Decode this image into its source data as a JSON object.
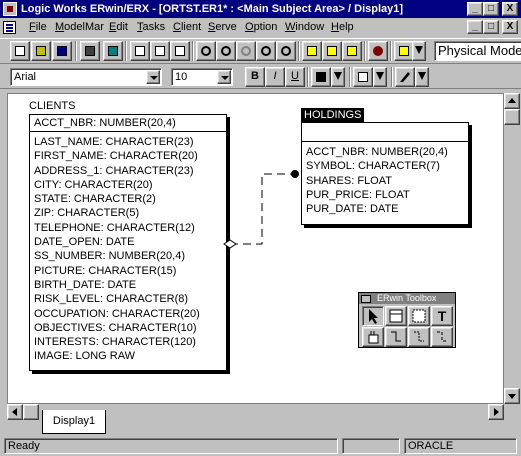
{
  "window": {
    "title": "Logic Works ERwin/ERX - [ORTST.ER1* : <Main Subject Area> / Display1]",
    "controls_outer": [
      "_",
      "□",
      "X"
    ],
    "controls_inner": [
      "_",
      "□",
      "X"
    ]
  },
  "menu": {
    "items": [
      "File",
      "ModelMar",
      "Edit",
      "Tasks",
      "Client",
      "Serve",
      "Option",
      "Window",
      "Help"
    ]
  },
  "toolbar": {
    "mode_selector": "Physical Mode"
  },
  "format_bar": {
    "font_name": "Arial",
    "font_size": "10",
    "bold": "B",
    "italic": "I",
    "underline": "U"
  },
  "diagram": {
    "clients": {
      "label": "CLIENTS",
      "primary_key": "ACCT_NBR: NUMBER(20,4)",
      "attributes": [
        "LAST_NAME: CHARACTER(23)",
        "FIRST_NAME: CHARACTER(20)",
        "ADDRESS_1: CHARACTER(23)",
        "CITY: CHARACTER(20)",
        "STATE: CHARACTER(2)",
        "ZIP: CHARACTER(5)",
        "TELEPHONE: CHARACTER(12)",
        "DATE_OPEN: DATE",
        "SS_NUMBER: NUMBER(20,4)",
        "PICTURE: CHARACTER(15)",
        "BIRTH_DATE: DATE",
        "RISK_LEVEL: CHARACTER(8)",
        "OCCUPATION: CHARACTER(20)",
        "OBJECTIVES: CHARACTER(10)",
        "INTERESTS: CHARACTER(120)",
        "IMAGE: LONG RAW"
      ]
    },
    "holdings": {
      "label": "HOLDINGS",
      "primary_key": "",
      "attributes": [
        "ACCT_NBR: NUMBER(20,4)",
        "SYMBOL: CHARACTER(7)",
        "SHARES: FLOAT",
        "PUR_PRICE: FLOAT",
        "PUR_DATE: DATE"
      ]
    }
  },
  "toolbox": {
    "title": "ERwin Toolbox",
    "text_tool": "T"
  },
  "tabs": [
    "Display1"
  ],
  "status": {
    "message": "Ready",
    "database": "ORACLE"
  },
  "colors": {
    "titlebar": "#000080",
    "chrome": "#c0c0c0",
    "canvas": "#ffffff",
    "entity_label_bg": "#000000"
  }
}
